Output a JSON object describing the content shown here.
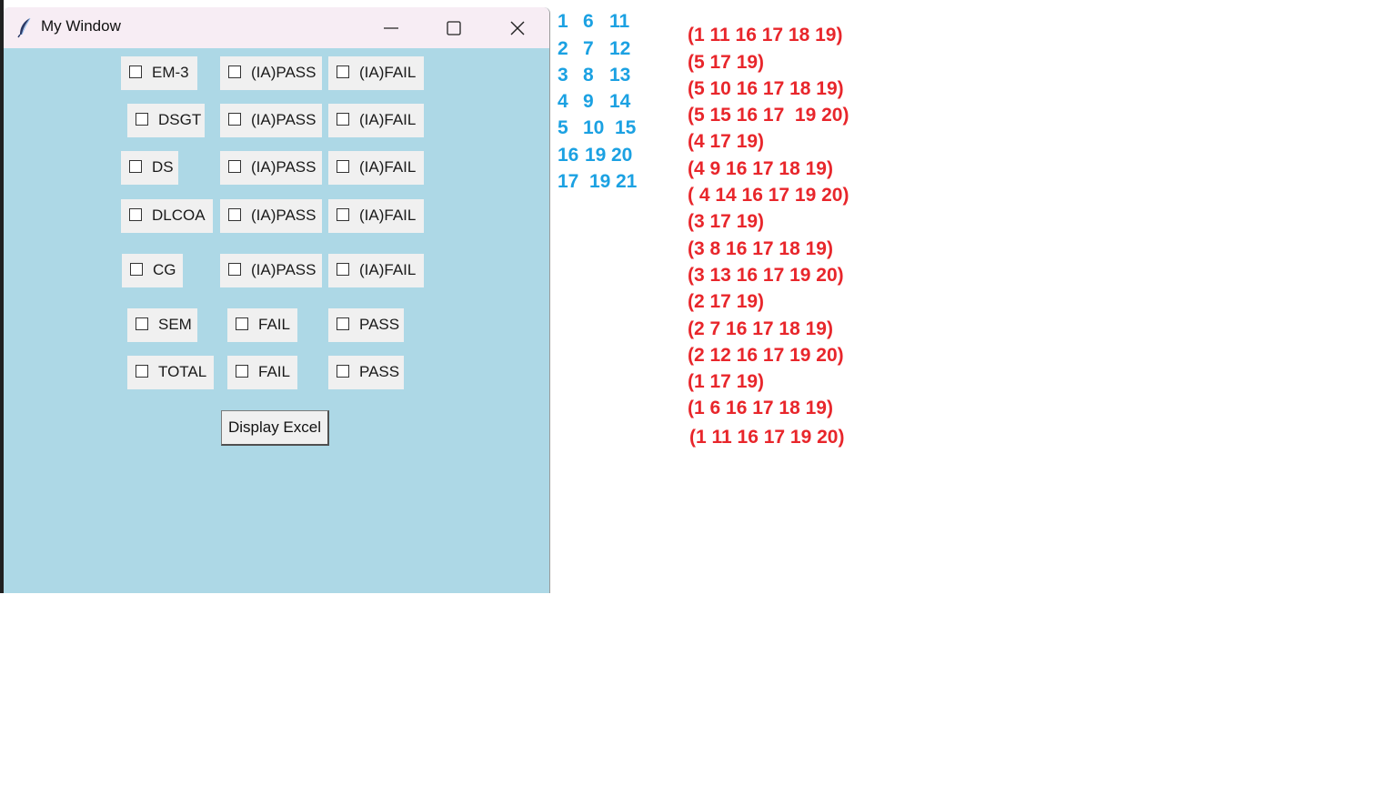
{
  "window": {
    "title": "My Window",
    "controls": {
      "minimize": "minimize-icon",
      "maximize": "maximize-icon",
      "close": "close-icon"
    }
  },
  "rows": [
    {
      "subject": "EM-3",
      "option1": "(IA)PASS",
      "option2": "(IA)FAIL"
    },
    {
      "subject": "DSGT",
      "option1": "(IA)PASS",
      "option2": "(IA)FAIL"
    },
    {
      "subject": "DS",
      "option1": "(IA)PASS",
      "option2": "(IA)FAIL"
    },
    {
      "subject": "DLCOA",
      "option1": "(IA)PASS",
      "option2": "(IA)FAIL"
    },
    {
      "subject": "CG",
      "option1": "(IA)PASS",
      "option2": "(IA)FAIL"
    },
    {
      "subject": "SEM",
      "option1": "FAIL",
      "option2": "PASS"
    },
    {
      "subject": "TOTAL",
      "option1": "FAIL",
      "option2": "PASS"
    }
  ],
  "display_button": "Display Excel",
  "blue_numbers": [
    [
      "1",
      "6",
      "11"
    ],
    [
      "2",
      "7",
      "12"
    ],
    [
      "3",
      "8",
      "13"
    ],
    [
      "4",
      "9",
      "14"
    ],
    [
      "5",
      "10",
      "15"
    ],
    [
      "16",
      "19",
      "20"
    ],
    [
      "17",
      "19",
      "21"
    ]
  ],
  "red_lines": [
    "(1 11 16 17 18 19)",
    "(5 17 19)",
    "(5 10 16 17 18 19)",
    "(5 15 16 17  19 20)",
    "(4 17 19)",
    "(4 9 16 17 18 19)",
    "( 4 14 16 17 19 20)",
    "(3 17 19)",
    "(3 8 16 17 18 19)",
    "(3 13 16 17 19 20)",
    "(2 17 19)",
    "(2 7 16 17 18 19)",
    "(2 12 16 17 19 20)",
    "(1 17 19)",
    "(1 6 16 17 18 19)",
    "(1 11 16 17 19 20)"
  ],
  "colors": {
    "window_bg": "#add8e6",
    "titlebar_bg": "#f7edf4",
    "checkbox_bg": "#f0f0f0",
    "blue_text": "#1ba1e2",
    "red_text": "#e8262b"
  },
  "icons": {
    "app": "feather-icon"
  }
}
